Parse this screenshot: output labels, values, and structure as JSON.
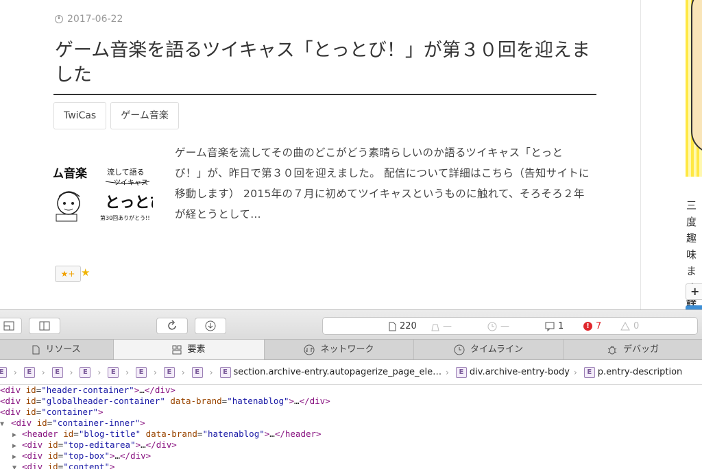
{
  "article": {
    "date": "2017-06-22",
    "title": "ゲーム音楽を語るツイキャス「とっとび！」が第３０回を迎えました",
    "tags": [
      "TwiCas",
      "ゲーム音楽"
    ],
    "thumbnail_text": {
      "line1": "ゲーム音楽",
      "line2": "流して語る",
      "line3": "ツイキャス",
      "logo": "とっとび",
      "caption": "第30回ありがとう!!"
    },
    "excerpt": "ゲーム音楽を流してその曲のどこがどう素晴らしいのか語るツイキャス「とっとび！」が、昨日で第３０回を迎えました。 配信について詳細はこちら（告知サイトに移動します） 2015年の７月に初めてツイキャスというものに触れて、そろそろ２年が経とうとして…",
    "star_button": "★+",
    "star": "★"
  },
  "sidebar": {
    "text_lines": [
      "三度",
      "趣味",
      "ます",
      "詳し"
    ],
    "plus_button": "+"
  },
  "devtools": {
    "status": {
      "lines": "220",
      "resources": "—",
      "time": "—",
      "logs": "1",
      "errors": "7",
      "warnings": "0"
    },
    "tabs": [
      {
        "label": "リソース",
        "icon": "document-icon"
      },
      {
        "label": "要素",
        "icon": "elements-icon"
      },
      {
        "label": "ネットワーク",
        "icon": "network-icon"
      },
      {
        "label": "タイムライン",
        "icon": "clock-icon"
      },
      {
        "label": "デバッガ",
        "icon": "bug-icon"
      }
    ],
    "breadcrumb_badge": "E",
    "breadcrumb": [
      "section.archive-entry.autopagerize_page_ele…",
      "div.archive-entry-body",
      "p.entry-description"
    ],
    "dom": [
      {
        "tag": "div",
        "attrs": [
          [
            "id",
            "\"header-container\""
          ]
        ],
        "collapsed": "…",
        "close": "div",
        "indent": 0,
        "arrow": ""
      },
      {
        "tag": "div",
        "attrs": [
          [
            "id",
            "\"globalheader-container\""
          ],
          [
            "data-brand",
            "\"hatenablog\""
          ]
        ],
        "collapsed": "…",
        "close": "div",
        "indent": 0,
        "arrow": ""
      },
      {
        "tag": "div",
        "attrs": [
          [
            "id",
            "\"container\""
          ]
        ],
        "collapsed": "",
        "close": "",
        "indent": 0,
        "arrow": ""
      },
      {
        "tag": "div",
        "attrs": [
          [
            "id",
            "\"container-inner\""
          ]
        ],
        "collapsed": "",
        "close": "",
        "indent": 0,
        "arrow": "▼"
      },
      {
        "tag": "header",
        "attrs": [
          [
            "id",
            "\"blog-title\""
          ],
          [
            "data-brand",
            "\"hatenablog\""
          ]
        ],
        "collapsed": "…",
        "close": "header",
        "indent": 1,
        "arrow": "▶"
      },
      {
        "tag": "div",
        "attrs": [
          [
            "id",
            "\"top-editarea\""
          ]
        ],
        "collapsed": "…",
        "close": "div",
        "indent": 1,
        "arrow": "▶"
      },
      {
        "tag": "div",
        "attrs": [
          [
            "id",
            "\"top-box\""
          ]
        ],
        "collapsed": "…",
        "close": "div",
        "indent": 1,
        "arrow": "▶"
      },
      {
        "tag": "div",
        "attrs": [
          [
            "id",
            "\"content\""
          ]
        ],
        "collapsed": "",
        "close": "",
        "indent": 1,
        "arrow": "▼"
      }
    ]
  }
}
